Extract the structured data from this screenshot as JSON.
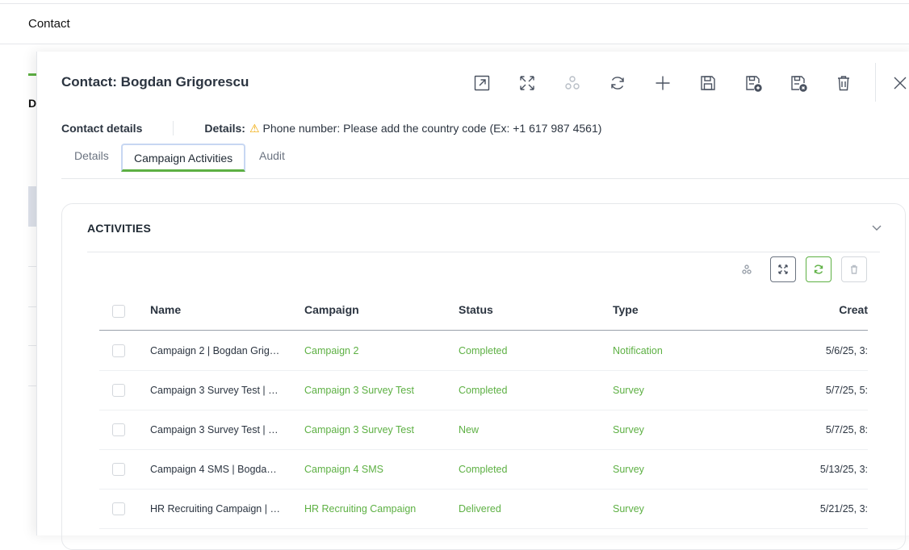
{
  "page": {
    "title": "Contact",
    "hint_letter": "D"
  },
  "panel": {
    "title": "Contact: Bogdan Grigorescu",
    "toolbar": [
      {
        "name": "open-external-icon"
      },
      {
        "name": "expand-icon"
      },
      {
        "name": "hierarchy-icon",
        "disabled": true
      },
      {
        "name": "refresh-icon"
      },
      {
        "name": "add-icon"
      },
      {
        "name": "save-icon"
      },
      {
        "name": "save-new-icon"
      },
      {
        "name": "save-close-icon"
      },
      {
        "name": "delete-icon"
      },
      {
        "name": "close-icon"
      }
    ]
  },
  "details": {
    "section_label": "Contact details",
    "label": "Details:",
    "warning_icon": "⚠",
    "message": "Phone number: Please add the country code (Ex: +1 617 987 4561)"
  },
  "tabs": [
    {
      "label": "Details"
    },
    {
      "label": "Campaign Activities",
      "active": true
    },
    {
      "label": "Audit"
    }
  ],
  "activities": {
    "title": "ACTIVITIES",
    "columns": {
      "name": "Name",
      "campaign": "Campaign",
      "status": "Status",
      "type": "Type",
      "created": "Creat"
    },
    "rows": [
      {
        "name": "Campaign 2 | Bogdan Grig…",
        "campaign": "Campaign 2",
        "status": "Completed",
        "type": "Notification",
        "created": "5/6/25, 3:"
      },
      {
        "name": "Campaign 3 Survey Test | …",
        "campaign": "Campaign 3 Survey Test",
        "status": "Completed",
        "type": "Survey",
        "created": "5/7/25, 5:"
      },
      {
        "name": "Campaign 3 Survey Test | …",
        "campaign": "Campaign 3 Survey Test",
        "status": "New",
        "type": "Survey",
        "created": "5/7/25, 8:"
      },
      {
        "name": "Campaign 4 SMS | Bogda…",
        "campaign": "Campaign 4 SMS",
        "status": "Completed",
        "type": "Survey",
        "created": "5/13/25, 3:"
      },
      {
        "name": "HR Recruiting Campaign | …",
        "campaign": "HR Recruiting Campaign",
        "status": "Delivered",
        "type": "Survey",
        "created": "5/21/25, 3:"
      }
    ]
  },
  "colors": {
    "accent": "#5db043",
    "text": "#2b3440",
    "warning": "#f0a800"
  }
}
